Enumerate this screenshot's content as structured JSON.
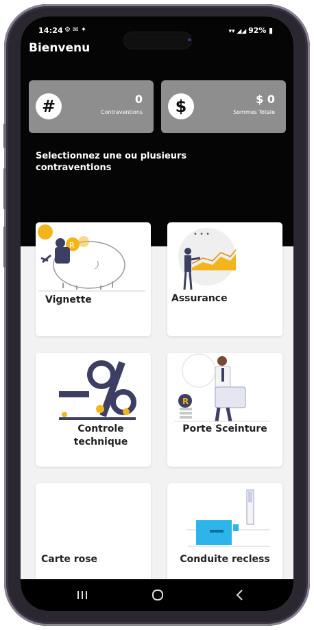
{
  "status_bar": {
    "time": "14:24",
    "battery": "92%"
  },
  "header": {
    "greeting": "Bienvenu"
  },
  "stats": {
    "violations": {
      "icon": "hash-icon",
      "symbol": "#",
      "value": "0",
      "label": "Contraventions"
    },
    "total": {
      "icon": "dollar-icon",
      "symbol": "$",
      "value": "$ 0",
      "label": "Sommes Totale"
    }
  },
  "prompt": "Selectionnez une ou plusieurs contraventions",
  "categories": [
    {
      "label": "Vignette",
      "icon": "piggy-bank-illustration"
    },
    {
      "label": "Assurance",
      "icon": "growth-chart-illustration"
    },
    {
      "label": "Controle technique",
      "icon": "percent-illustration"
    },
    {
      "label": "Porte Sceinture",
      "icon": "person-with-card-illustration"
    },
    {
      "label": "Carte rose",
      "icon": ""
    },
    {
      "label": "Conduite recless",
      "icon": "payment-terminal-illustration"
    }
  ],
  "colors": {
    "dark_header": "#050505",
    "card_gray": "#8e8e8e",
    "accent_yellow": "#f2b51c",
    "accent_blue": "#2db4ea",
    "text_dark": "#222222"
  }
}
